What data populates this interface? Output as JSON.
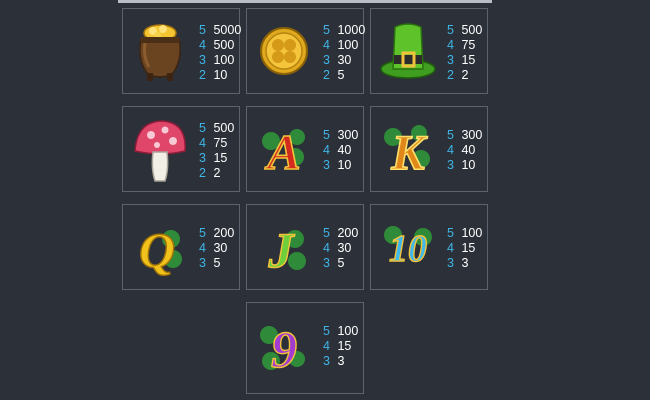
{
  "colors": {
    "background": "#2c3038",
    "border": "#5d636c",
    "count": "#3fb5e6",
    "value": "#ffffff"
  },
  "symbols": [
    {
      "icon": "pot-of-gold-icon",
      "pays": [
        {
          "count": "5",
          "value": "5000"
        },
        {
          "count": "4",
          "value": "500"
        },
        {
          "count": "3",
          "value": "100"
        },
        {
          "count": "2",
          "value": "10"
        }
      ]
    },
    {
      "icon": "gold-clover-coin-icon",
      "pays": [
        {
          "count": "5",
          "value": "1000"
        },
        {
          "count": "4",
          "value": "100"
        },
        {
          "count": "3",
          "value": "30"
        },
        {
          "count": "2",
          "value": "5"
        }
      ]
    },
    {
      "icon": "leprechaun-hat-icon",
      "pays": [
        {
          "count": "5",
          "value": "500"
        },
        {
          "count": "4",
          "value": "75"
        },
        {
          "count": "3",
          "value": "15"
        },
        {
          "count": "2",
          "value": "2"
        }
      ]
    },
    {
      "icon": "mushroom-icon",
      "pays": [
        {
          "count": "5",
          "value": "500"
        },
        {
          "count": "4",
          "value": "75"
        },
        {
          "count": "3",
          "value": "15"
        },
        {
          "count": "2",
          "value": "2"
        }
      ]
    },
    {
      "icon": "letter-a-icon",
      "letter": "A",
      "pays": [
        {
          "count": "5",
          "value": "300"
        },
        {
          "count": "4",
          "value": "40"
        },
        {
          "count": "3",
          "value": "10"
        }
      ]
    },
    {
      "icon": "letter-k-icon",
      "letter": "K",
      "pays": [
        {
          "count": "5",
          "value": "300"
        },
        {
          "count": "4",
          "value": "40"
        },
        {
          "count": "3",
          "value": "10"
        }
      ]
    },
    {
      "icon": "letter-q-icon",
      "letter": "Q",
      "pays": [
        {
          "count": "5",
          "value": "200"
        },
        {
          "count": "4",
          "value": "30"
        },
        {
          "count": "3",
          "value": "5"
        }
      ]
    },
    {
      "icon": "letter-j-icon",
      "letter": "J",
      "pays": [
        {
          "count": "5",
          "value": "200"
        },
        {
          "count": "4",
          "value": "30"
        },
        {
          "count": "3",
          "value": "5"
        }
      ]
    },
    {
      "icon": "number-10-icon",
      "letter": "10",
      "pays": [
        {
          "count": "5",
          "value": "100"
        },
        {
          "count": "4",
          "value": "15"
        },
        {
          "count": "3",
          "value": "3"
        }
      ]
    },
    {
      "icon": "number-9-icon",
      "letter": "9",
      "pays": [
        {
          "count": "5",
          "value": "100"
        },
        {
          "count": "4",
          "value": "15"
        },
        {
          "count": "3",
          "value": "3"
        }
      ]
    }
  ]
}
